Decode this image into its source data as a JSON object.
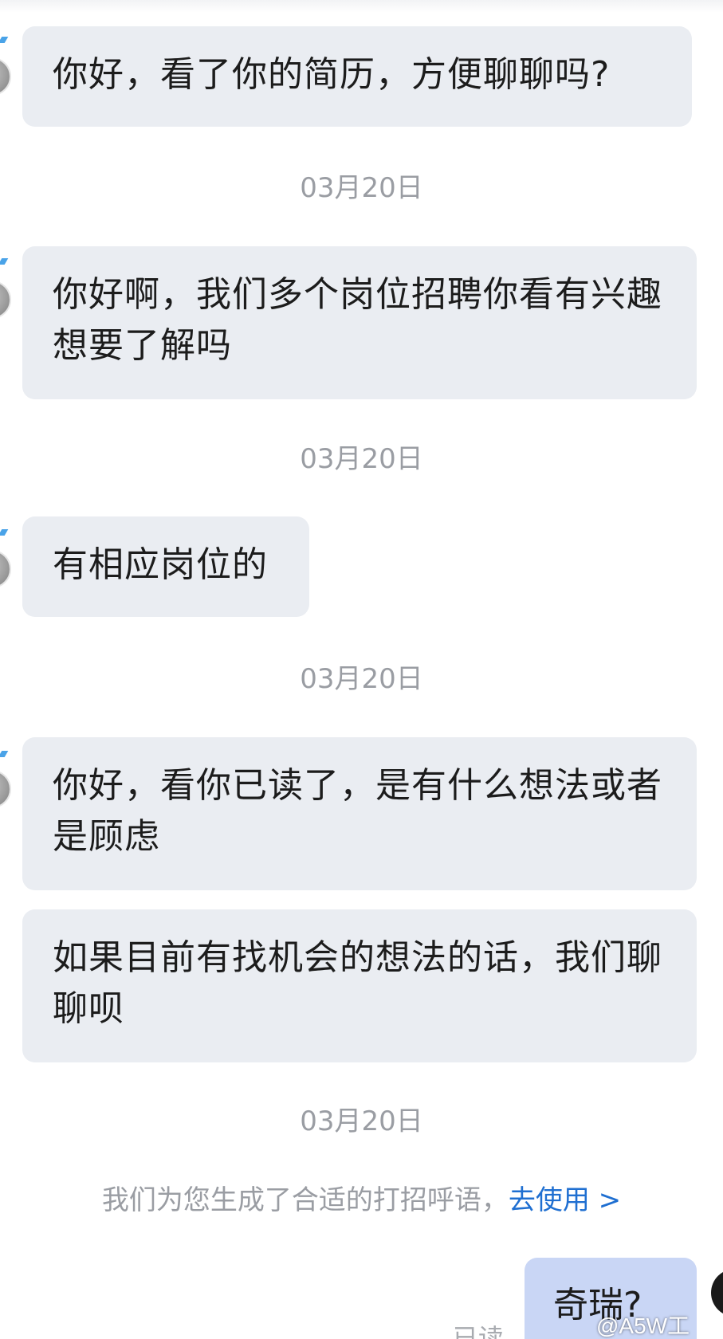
{
  "messages": [
    {
      "text": "你好，看了你的简历，方便聊聊吗?"
    },
    {
      "text": "你好啊，我们多个岗位招聘你看有兴趣想要了解吗"
    },
    {
      "text": "有相应岗位的"
    },
    {
      "text": "你好，看你已读了，是有什么想法或者是顾虑"
    },
    {
      "text": "如果目前有找机会的想法的话，我们聊聊呗"
    }
  ],
  "timestamps": [
    "03月20日",
    "03月20日",
    "03月20日",
    "03月20日"
  ],
  "suggestion": {
    "text": "我们为您生成了合适的打招呼语，",
    "link": "去使用 >"
  },
  "self_message": {
    "text": "奇瑞?"
  },
  "read_status": "已读",
  "watermark": "@A5W工"
}
